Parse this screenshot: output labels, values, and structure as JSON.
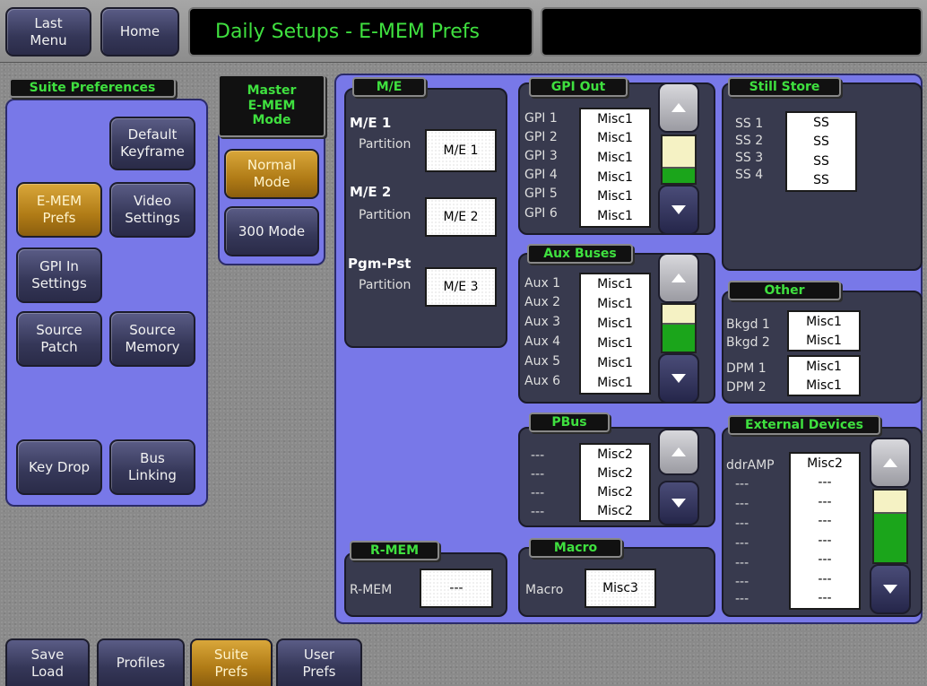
{
  "header": {
    "last_menu": "Last\nMenu",
    "home": "Home",
    "title": "Daily Setups - E-MEM Prefs",
    "right_box": ""
  },
  "suite_prefs": {
    "label": "Suite Preferences",
    "buttons": [
      "Default\nKeyframe",
      "E-MEM\nPrefs",
      "Video\nSettings",
      "GPI In\nSettings",
      "Source\nPatch",
      "Source\nMemory",
      "Key Drop",
      "Bus\nLinking"
    ]
  },
  "master_mode": {
    "label": "Master\nE-MEM\nMode",
    "normal": "Normal\nMode",
    "m300": "300 Mode"
  },
  "me": {
    "label": "M/E",
    "me1": "M/E 1",
    "me2": "M/E 2",
    "pgm": "Pgm-Pst",
    "partition": "Partition",
    "values": [
      "M/E 1",
      "M/E 2",
      "M/E 3"
    ]
  },
  "gpi_out": {
    "label": "GPI Out",
    "rows": [
      "GPI 1",
      "GPI 2",
      "GPI 3",
      "GPI 4",
      "GPI 5",
      "GPI 6"
    ],
    "values": [
      "Misc1",
      "Misc1",
      "Misc1",
      "Misc1",
      "Misc1",
      "Misc1"
    ],
    "scroll_fraction": 0.72
  },
  "still_store": {
    "label": "Still Store",
    "rows": [
      "SS 1",
      "SS 2",
      "SS 3",
      "SS 4"
    ],
    "values": [
      "SS",
      "SS",
      "SS",
      "SS"
    ]
  },
  "aux": {
    "label": "Aux Buses",
    "rows": [
      "Aux 1",
      "Aux 2",
      "Aux 3",
      "Aux 4",
      "Aux 5",
      "Aux 6"
    ],
    "values": [
      "Misc1",
      "Misc1",
      "Misc1",
      "Misc1",
      "Misc1",
      "Misc1"
    ]
  },
  "other": {
    "label": "Other",
    "bkgd1": "Bkgd 1",
    "bkgd2": "Bkgd 2",
    "dpm1": "DPM 1",
    "dpm2": "DPM 2",
    "bkgd_values": [
      "Misc1",
      "Misc1"
    ],
    "dpm_values": [
      "Misc1",
      "Misc1"
    ]
  },
  "pbus": {
    "label": "PBus",
    "rows": [
      "---",
      "---",
      "---",
      "---"
    ],
    "values": [
      "Misc2",
      "Misc2",
      "Misc2",
      "Misc2"
    ]
  },
  "external": {
    "label": "External Devices",
    "rows": [
      "ddrAMP",
      "---",
      "---",
      "---",
      "---",
      "---",
      "---",
      "---"
    ],
    "values": [
      "Misc2",
      "---",
      "---",
      "---",
      "---",
      "---",
      "---",
      "---"
    ]
  },
  "rmem": {
    "label": "R-MEM",
    "field_label": "R-MEM",
    "value": "---"
  },
  "macro": {
    "label": "Macro",
    "field_label": "Macro",
    "value": "Misc3"
  },
  "tabs": [
    "Save\nLoad",
    "Profiles",
    "Suite\nPrefs",
    "User\nPrefs"
  ],
  "colors": {
    "accent": "#3fe03f",
    "panel": "#7878e8",
    "active": "#d19c2e"
  }
}
